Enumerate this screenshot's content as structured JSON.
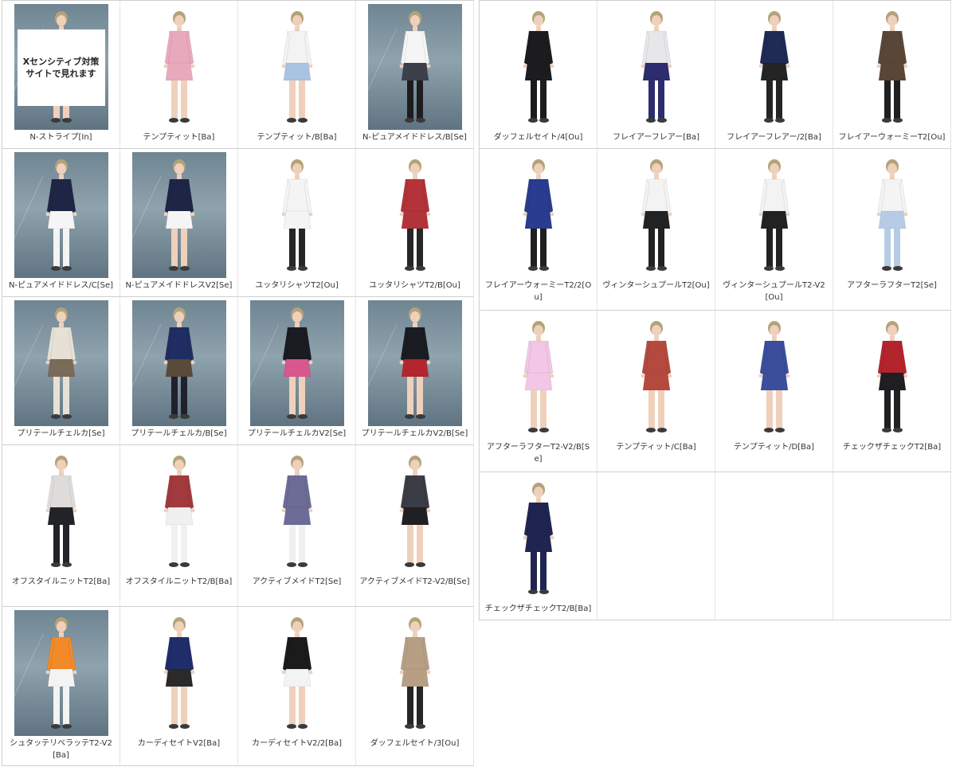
{
  "overlay_text": "Xセンシティブ対策\nサイトで見れます",
  "left_table": {
    "rows": [
      {
        "height": 186,
        "items": [
          {
            "label": "N-ストライプ[In]",
            "bg": "studio",
            "top": "#ffffff",
            "bottom": "#ffffff",
            "legs": "skin",
            "overlay": true
          },
          {
            "label": "テンプティット[Ba]",
            "bg": "white",
            "top": "#e9a9bd",
            "bottom": "#e9a9bd",
            "legs": "skin"
          },
          {
            "label": "テンプティット/B[Ba]",
            "bg": "white",
            "top": "#f3f3f3",
            "bottom": "#a9c3e3",
            "legs": "skin"
          },
          {
            "label": "N-ピュアメイドドレス/B[Se]",
            "bg": "studio",
            "top": "#f5f5f5",
            "bottom": "#3d3f4a",
            "legs": "#1d1d1f"
          }
        ]
      },
      {
        "height": 186,
        "items": [
          {
            "label": "N-ピュアメイドドレス/C[Se]",
            "bg": "studio",
            "top": "#1f2545",
            "bottom": "#f5f5f5",
            "legs": "#f4f4f4"
          },
          {
            "label": "N-ピュアメイドドレスV2[Se]",
            "bg": "studio",
            "top": "#1f2545",
            "bottom": "#f5f5f5",
            "legs": "skin"
          },
          {
            "label": "ユッタリシャツT2[Ou]",
            "bg": "white",
            "top": "#f4f4f4",
            "bottom": "#f4f4f4",
            "legs": "#262626"
          },
          {
            "label": "ユッタリシャツT2/B[Ou]",
            "bg": "white",
            "top": "#b2333a",
            "bottom": "#b2333a",
            "legs": "#262626"
          }
        ]
      },
      {
        "height": 186,
        "items": [
          {
            "label": "プリテールチェルカ[Se]",
            "bg": "studio",
            "top": "#e7e1d5",
            "bottom": "#7a6a58",
            "legs": "#e7e1d5"
          },
          {
            "label": "プリテールチェルカ/B[Se]",
            "bg": "studio",
            "top": "#1f2d63",
            "bottom": "#5a4a3a",
            "legs": "#20212a"
          },
          {
            "label": "プリテールチェルカV2[Se]",
            "bg": "studio",
            "top": "#1b1b22",
            "bottom": "#d9578f",
            "legs": "skin"
          },
          {
            "label": "プリテールチェルカV2/B[Se]",
            "bg": "studio",
            "top": "#1b1b22",
            "bottom": "#b3262f",
            "legs": "skin"
          }
        ]
      },
      {
        "height": 203,
        "items": [
          {
            "label": "オフスタイルニットT2[Ba]",
            "bg": "white",
            "top": "#dedcdb",
            "bottom": "#222326",
            "legs": "#222326"
          },
          {
            "label": "オフスタイルニットT2/B[Ba]",
            "bg": "white",
            "top": "#a13a3d",
            "bottom": "#f0f0f0",
            "legs": "#f0f0f0"
          },
          {
            "label": "アクティブメイドT2[Se]",
            "bg": "white",
            "top": "#6d6c96",
            "bottom": "#6d6c96",
            "legs": "#f0f0f0"
          },
          {
            "label": "アクティブメイドT2-V2/B[Se]",
            "bg": "white",
            "top": "#3b3d44",
            "bottom": "#1f1f24",
            "legs": "skin"
          }
        ]
      },
      {
        "height": 200,
        "items": [
          {
            "label": "シュタッテリベラッテT2-V2[Ba]",
            "bg": "studio",
            "top": "#f28a2a",
            "bottom": "#f3f3f3",
            "legs": "#f3f3f3"
          },
          {
            "label": "カーディセイトV2[Ba]",
            "bg": "white",
            "top": "#1f2d6b",
            "bottom": "#2a2a2a",
            "legs": "skin"
          },
          {
            "label": "カーディセイトV2/2[Ba]",
            "bg": "white",
            "top": "#1b1b1b",
            "bottom": "#f3f3f3",
            "legs": "skin"
          },
          {
            "label": "ダッフェルセイト/3[Ou]",
            "bg": "white",
            "top": "#b79f84",
            "bottom": "#b79f84",
            "legs": "#262626"
          }
        ]
      }
    ]
  },
  "right_table": {
    "rows": [
      {
        "height": 186,
        "items": [
          {
            "label": "ダッフェルセイト/4[Ou]",
            "bg": "white",
            "top": "#1c1c1e",
            "bottom": "#1c1c1e",
            "legs": "#1c1c1e"
          },
          {
            "label": "フレイアーフレアー[Ba]",
            "bg": "white",
            "top": "#e7e7ea",
            "bottom": "#2d2c6e",
            "legs": "#2d2c6e"
          },
          {
            "label": "フレイアーフレアー/2[Ba]",
            "bg": "white",
            "top": "#1f2b55",
            "bottom": "#242424",
            "legs": "#242424"
          },
          {
            "label": "フレイアーウォーミーT2[Ou]",
            "bg": "white",
            "top": "#5a4636",
            "bottom": "#5a4636",
            "legs": "#1f1f1f"
          }
        ]
      },
      {
        "height": 203,
        "items": [
          {
            "label": "フレイアーウォーミーT2/2[Ou]",
            "bg": "white",
            "top": "#2a3c8f",
            "bottom": "#2a3c8f",
            "legs": "#1f1f1f"
          },
          {
            "label": "ヴィンターシュプールT2[Ou]",
            "bg": "white",
            "top": "#f3f3f3",
            "bottom": "#222222",
            "legs": "#222222"
          },
          {
            "label": "ヴィンターシュプールT2-V2[Ou]",
            "bg": "white",
            "top": "#f3f3f3",
            "bottom": "#222222",
            "legs": "#222222"
          },
          {
            "label": "アフターラフターT2[Se]",
            "bg": "white",
            "top": "#f4f4f4",
            "bottom": "#b7cbe6",
            "legs": "#b7cbe6"
          }
        ]
      },
      {
        "height": 203,
        "items": [
          {
            "label": "アフターラフターT2-V2/B[Se]",
            "bg": "white",
            "top": "#f1c6e6",
            "bottom": "#f1c6e6",
            "legs": "skin"
          },
          {
            "label": "テンプティット/C[Ba]",
            "bg": "white",
            "top": "#b44a3e",
            "bottom": "#b44a3e",
            "legs": "skin"
          },
          {
            "label": "テンプティット/D[Ba]",
            "bg": "white",
            "top": "#3a4e9c",
            "bottom": "#3a4e9c",
            "legs": "skin"
          },
          {
            "label": "チェックザチェックT2[Ba]",
            "bg": "white",
            "top": "#b4242c",
            "bottom": "#1f1f22",
            "legs": "#1f1f22"
          }
        ]
      },
      {
        "height": 186,
        "items": [
          {
            "label": "チェックザチェックT2/B[Ba]",
            "bg": "white",
            "top": "#1f2550",
            "bottom": "#1f2550",
            "legs": "#1f2550"
          },
          {
            "label": "",
            "empty": true
          },
          {
            "label": "",
            "empty": true
          },
          {
            "label": "",
            "empty": true
          }
        ]
      }
    ]
  }
}
